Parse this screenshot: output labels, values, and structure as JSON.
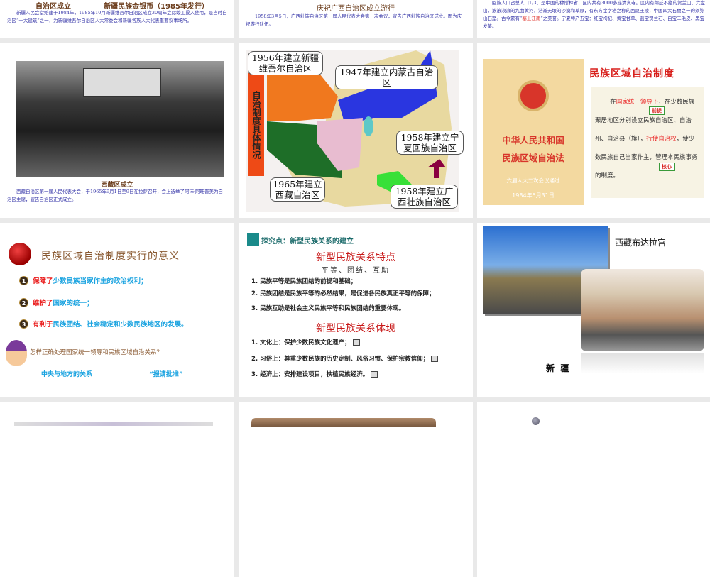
{
  "slides": [
    {
      "caption_left": "自治区成立",
      "caption_right": "新疆民族金银币（1985年发行）",
      "paragraph": "新疆人民会堂始建于1984年，1985年10月新疆维吾尔自治区成立30周年之际竣工投入使用，是当时自治区“十大建筑”之一，为新疆维吾尔自治区人大常委会和新疆各族人大代表重要议事场所。"
    },
    {
      "caption": "庆祝广西自治区成立游行",
      "paragraph": "1958年3月5日，广西壮族自治区第一届人民代表大会第一次会议，宣告广西壮族自治区成立。图为庆祝游行队伍。"
    },
    {
      "paragraph_a": "回族人口占总人口1/3，是中国的穆斯林省，区内共有3000多座清真寺。区内有绵延不绝的贺兰山、六盘山，滚滚浪浪的九曲黄河，浩瀚无垠的沙漠和草原，有东方金字塔之称的西夏王陵，中国四大石窟之一的须弥山石窟。古今素有“",
      "highlight": "塞上江南",
      "paragraph_b": "”之美誉。宁夏特产五宝：红宝枸杞、黄宝甘草、蓝宝贺兰石、白宝二毛皮、黑宝发菜。"
    },
    {
      "caption": "西藏区成立",
      "paragraph": "西藏自治区第一届人民代表大会，于1965年9月1日至9日在拉萨召开，会上选举了阿沛·阿旺晋美为自治区主席，宣告自治区正式成立。"
    },
    {
      "side_title": "自治制度具体情况",
      "labels": [
        "1956年建立新疆维吾尔自治区",
        "1947年建立内蒙古自治区",
        "1958年建立宁夏回族自治区",
        "1965年建立西藏自治区",
        "1958年建立广西壮族自治区"
      ]
    },
    {
      "book_title_1": "中华人民共和国",
      "book_title_2": "民族区域自治法",
      "book_sub": "六届人大二次会议通过",
      "book_date": "1984年5月31日",
      "title": "民族区域自治制度",
      "text_1": "在",
      "text_hl1": "国家统一领导下",
      "text_2": "，在少数民族聚居地区分别设立民族自治区、自治州、自治县（旗），",
      "text_hl2": "行使自治权",
      "text_3": "，使少数民族自己当家作主，管理本民族事务的制度。",
      "tag1": "前提",
      "tag2": "核心"
    },
    {
      "title": "民族区域自治制度实行的意义",
      "items": [
        {
          "n": "1",
          "red": "保障了",
          "blue": "少数民族当家作主的政治权利；"
        },
        {
          "n": "2",
          "red": "维护了",
          "blue": "国家的统一；"
        },
        {
          "n": "3",
          "red": "有利于",
          "blue": "民族团结、社会稳定和少数民族地区的发展。"
        }
      ],
      "question": "怎样正确处理国家统一领导和民族区域自治关系？",
      "answer_left": "中央与地方的关系",
      "answer_right": "“报请批准”"
    },
    {
      "heading": "探究点：新型民族关系的建立",
      "title1": "新型民族关系特点",
      "subtitle1": "平等、团结、互助",
      "points1": [
        "1. 民族平等是民族团结的前提和基础；",
        "2. 民族团结是民族平等的必然结果，是促进各民族真正平等的保障；",
        "3. 民族互助是社会主义民族平等和民族团结的重要体现。"
      ],
      "title2": "新型民族关系体现",
      "points2": [
        "1. 文化上：保护少数民族文化遗产；",
        "2. 习俗上：尊重少数民族的历史定制、风俗习惯、保护宗教信仰；",
        "3. 经济上：安排建设项目，扶植民族经济。"
      ]
    },
    {
      "label_top": "西藏布达拉宫",
      "label_bottom": "新  疆"
    }
  ]
}
